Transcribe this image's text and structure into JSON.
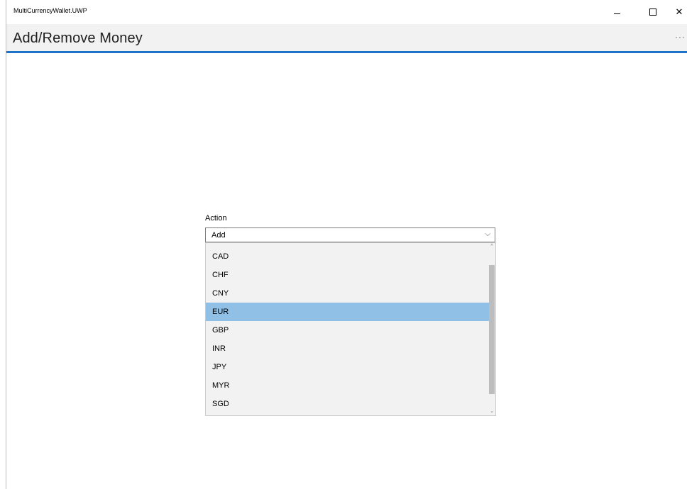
{
  "window": {
    "title": "MultiCurrencyWallet.UWP",
    "controls": {
      "minimize": "–",
      "maximize": "□",
      "close": "✕"
    }
  },
  "header": {
    "title": "Add/Remove Money",
    "more_label": "···"
  },
  "form": {
    "action_label": "Action",
    "action_value": "Add",
    "chevron": "⌵"
  },
  "dropdown": {
    "scroll_up": "^",
    "scroll_down": "⌄",
    "options": [
      {
        "label": "CAD",
        "selected": false
      },
      {
        "label": "CHF",
        "selected": false
      },
      {
        "label": "CNY",
        "selected": false
      },
      {
        "label": "EUR",
        "selected": true
      },
      {
        "label": "GBP",
        "selected": false
      },
      {
        "label": "INR",
        "selected": false
      },
      {
        "label": "JPY",
        "selected": false
      },
      {
        "label": "MYR",
        "selected": false
      },
      {
        "label": "SGD",
        "selected": false
      }
    ]
  },
  "colors": {
    "accent": "#1e73c8",
    "selection": "#91c0e6",
    "header_bg": "#f2f2f2"
  }
}
